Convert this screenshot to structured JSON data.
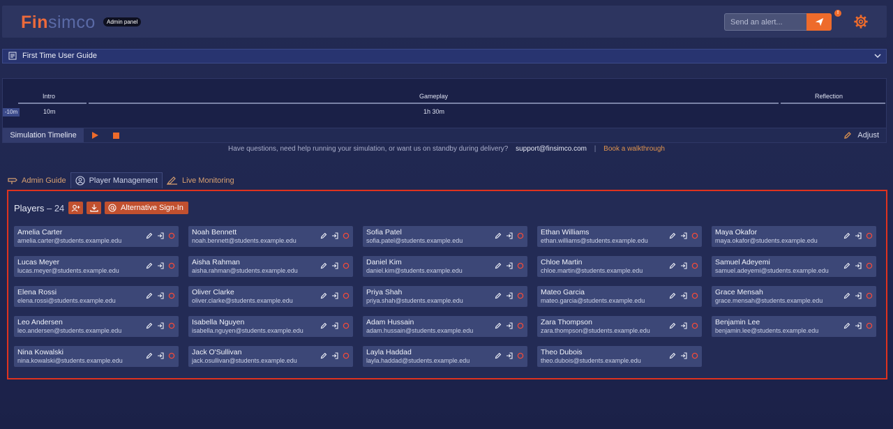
{
  "header": {
    "logo_fin": "Fin",
    "logo_simco": "simco",
    "admin_badge": "Admin panel",
    "alert_placeholder": "Send an alert...",
    "notification_count": "!"
  },
  "guide": {
    "label": "First Time User Guide"
  },
  "timeline": {
    "offset": "-10m",
    "segments": [
      {
        "label": "Intro",
        "duration": "10m"
      },
      {
        "label": "Gameplay",
        "duration": "1h 30m"
      },
      {
        "label": "Reflection",
        "duration": ""
      }
    ],
    "title": "Simulation Timeline",
    "adjust_label": "Adjust"
  },
  "help": {
    "text": "Have questions, need help running your simulation, or want us on standby during delivery?",
    "email": "support@finsimco.com",
    "separator": "|",
    "walkthrough": "Book a walkthrough"
  },
  "tabs": [
    {
      "label": "Admin Guide",
      "active": false
    },
    {
      "label": "Player Management",
      "active": true
    },
    {
      "label": "Live Monitoring",
      "active": false
    }
  ],
  "players": {
    "title": "Players",
    "count_text": "– 24",
    "alt_signin_label": "Alternative Sign-In",
    "list": [
      {
        "name": "Amelia Carter",
        "email": "amelia.carter@students.example.edu"
      },
      {
        "name": "Noah Bennett",
        "email": "noah.bennett@students.example.edu"
      },
      {
        "name": "Sofia Patel",
        "email": "sofia.patel@students.example.edu"
      },
      {
        "name": "Ethan Williams",
        "email": "ethan.williams@students.example.edu"
      },
      {
        "name": "Maya Okafor",
        "email": "maya.okafor@students.example.edu"
      },
      {
        "name": "Lucas Meyer",
        "email": "lucas.meyer@students.example.edu"
      },
      {
        "name": "Aisha Rahman",
        "email": "aisha.rahman@students.example.edu"
      },
      {
        "name": "Daniel Kim",
        "email": "daniel.kim@students.example.edu"
      },
      {
        "name": "Chloe Martin",
        "email": "chloe.martin@students.example.edu"
      },
      {
        "name": "Samuel Adeyemi",
        "email": "samuel.adeyemi@students.example.edu"
      },
      {
        "name": "Elena Rossi",
        "email": "elena.rossi@students.example.edu"
      },
      {
        "name": "Oliver Clarke",
        "email": "oliver.clarke@students.example.edu"
      },
      {
        "name": "Priya Shah",
        "email": "priya.shah@students.example.edu"
      },
      {
        "name": "Mateo Garcia",
        "email": "mateo.garcia@students.example.edu"
      },
      {
        "name": "Grace Mensah",
        "email": "grace.mensah@students.example.edu"
      },
      {
        "name": "Leo Andersen",
        "email": "leo.andersen@students.example.edu"
      },
      {
        "name": "Isabella Nguyen",
        "email": "isabella.nguyen@students.example.edu"
      },
      {
        "name": "Adam Hussain",
        "email": "adam.hussain@students.example.edu"
      },
      {
        "name": "Zara Thompson",
        "email": "zara.thompson@students.example.edu"
      },
      {
        "name": "Benjamin Lee",
        "email": "benjamin.lee@students.example.edu"
      },
      {
        "name": "Nina Kowalski",
        "email": "nina.kowalski@students.example.edu"
      },
      {
        "name": "Jack O'Sullivan",
        "email": "jack.osullivan@students.example.edu"
      },
      {
        "name": "Layla Haddad",
        "email": "layla.haddad@students.example.edu"
      },
      {
        "name": "Theo Dubois",
        "email": "theo.dubois@students.example.edu"
      }
    ]
  },
  "colors": {
    "accent": "#ee6b2b",
    "highlight_border": "#e0321e",
    "card_bg": "#3c4777"
  }
}
